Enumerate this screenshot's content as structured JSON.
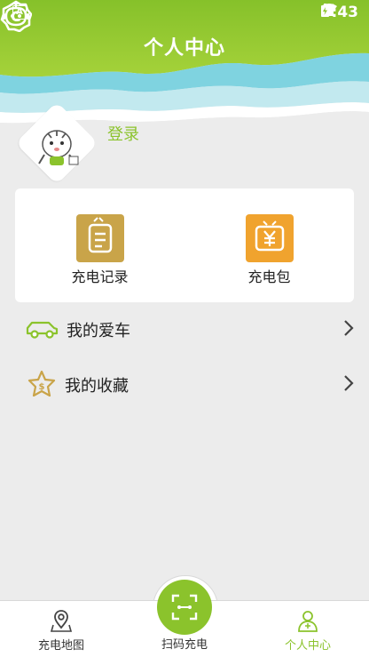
{
  "status_bar": {
    "time": "3:43",
    "left_icon_letter": "A"
  },
  "header": {
    "title": "个人中心",
    "icons": [
      "robot-icon",
      "settings-icon"
    ]
  },
  "profile": {
    "login_label": "登录"
  },
  "shortcuts": [
    {
      "label": "充电记录",
      "icon": "records-icon",
      "color": "#c9a449"
    },
    {
      "label": "充电包",
      "icon": "package-icon",
      "color": "#f0a32e"
    }
  ],
  "menu": [
    {
      "label": "我的爱车",
      "icon": "car-icon"
    },
    {
      "label": "我的收藏",
      "icon": "star-icon"
    }
  ],
  "bottom_nav": [
    {
      "label": "充电地图",
      "icon": "map-pin-icon",
      "active": false
    },
    {
      "label": "扫码充电",
      "icon": "scan-icon",
      "active": false
    },
    {
      "label": "个人中心",
      "icon": "person-icon",
      "active": true
    }
  ],
  "colors": {
    "accent": "#8bc32c",
    "background": "#ececec",
    "header_green": "#8bc32c",
    "wave_blue": "#7fd3e0"
  }
}
